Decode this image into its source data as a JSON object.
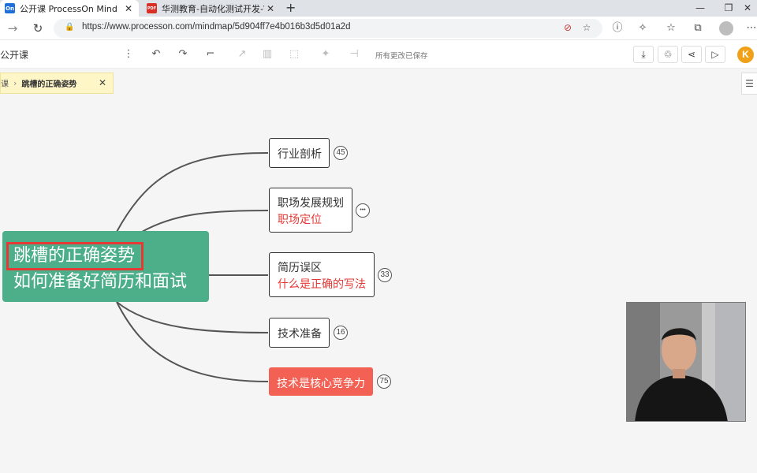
{
  "browser": {
    "tabs": [
      {
        "label": "公开课 ProcessOn Mind",
        "favicon": "On",
        "active": true
      },
      {
        "label": "华测教育-自动化测试开发-VIP课",
        "favicon": "PDF",
        "active": false
      }
    ],
    "url": "https://www.processon.com/mindmap/5d904ff7e4b016b3d5d01a2d"
  },
  "toolbar": {
    "doc_title": "公开课",
    "save_status": "所有更改已保存",
    "user_initial": "K"
  },
  "breadcrumb": {
    "parent": "课",
    "current": "跳槽的正确姿势"
  },
  "mindmap": {
    "root_line1": "跳槽的正确姿势",
    "root_line2": "如何准备好简历和面试",
    "nodes": [
      {
        "title": "行业剖析",
        "badge": "45"
      },
      {
        "title": "职场发展规划",
        "subtitle": "职场定位",
        "badge": "•••"
      },
      {
        "title": "简历误区",
        "subtitle": "什么是正确的写法",
        "badge": "33"
      },
      {
        "title": "技术准备",
        "badge": "16"
      },
      {
        "title": "技术是核心竞争力",
        "badge": "75"
      }
    ]
  },
  "colors": {
    "root": "#4caf8a",
    "highlight_node": "#f36155",
    "accent_text": "#e53935",
    "user_avatar": "#f0a11a"
  }
}
